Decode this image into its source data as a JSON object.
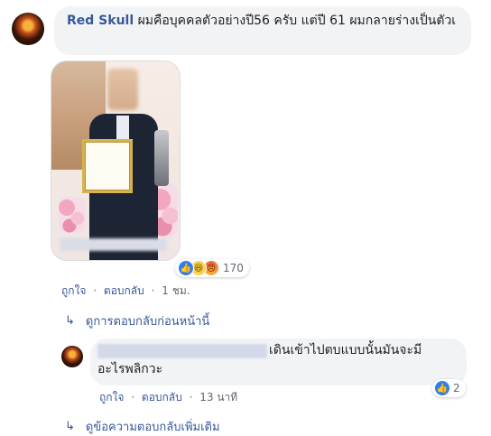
{
  "comment": {
    "author": "Red Skull",
    "text": "ผมคือบุคคลตัวอย่างปี56 ครับ แต่ปี 61 ผมกลายร่างเป็นตัวเ",
    "reactions": {
      "icons": [
        "like-icon",
        "haha-icon",
        "angry-icon"
      ],
      "count": "170"
    },
    "actions": {
      "like": "ถูกใจ",
      "reply": "ตอบกลับ",
      "time": "1 ชม."
    }
  },
  "view_previous_replies": "ดูการตอบกลับก่อนหน้านี้",
  "reply": {
    "text_line1": "เดินเข้าไปตบแบบนั้นมันจะมี",
    "text_line2": "อะไรพลิกวะ",
    "like_count": "2",
    "actions": {
      "like": "ถูกใจ",
      "reply": "ตอบกลับ",
      "time": "13 นาที"
    }
  },
  "view_more_replies": "ดูข้อความตอบกลับเพิ่มเติม",
  "colors": {
    "link": "#385898",
    "bubble": "#f2f3f5",
    "like_blue": "#2f7ef1"
  }
}
